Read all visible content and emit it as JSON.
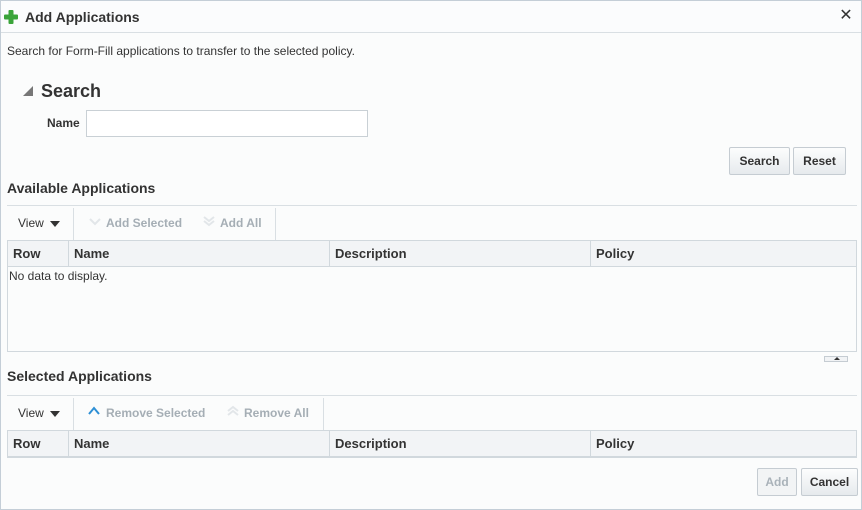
{
  "dialog": {
    "title": "Add Applications",
    "close_glyph": "✕",
    "intro": "Search for Form-Fill applications to transfer to the selected policy."
  },
  "search": {
    "title": "Search",
    "name_label": "Name",
    "name_value": "",
    "name_placeholder": "",
    "search_button": "Search",
    "reset_button": "Reset"
  },
  "available": {
    "title": "Available Applications",
    "toolbar": {
      "view": "View",
      "add_selected": "Add Selected",
      "add_all": "Add All"
    },
    "columns": [
      "Row",
      "Name",
      "Description",
      "Policy"
    ],
    "empty_text": "No data to display."
  },
  "selected": {
    "title": "Selected Applications",
    "toolbar": {
      "view": "View",
      "remove_selected": "Remove Selected",
      "remove_all": "Remove All"
    },
    "columns": [
      "Row",
      "Name",
      "Description",
      "Policy"
    ]
  },
  "footer": {
    "add_button": "Add",
    "cancel_button": "Cancel"
  },
  "colors": {
    "accent_green": "#3aa43a",
    "accent_blue": "#2d8fd5",
    "disabled_text": "#a5aeb5"
  },
  "icons": {
    "title": "plus-icon",
    "close": "close-icon",
    "add_selected": "chevron-down-icon",
    "add_all": "double-chevron-down-icon",
    "remove_selected": "chevron-up-icon",
    "remove_all": "double-chevron-up-icon"
  }
}
